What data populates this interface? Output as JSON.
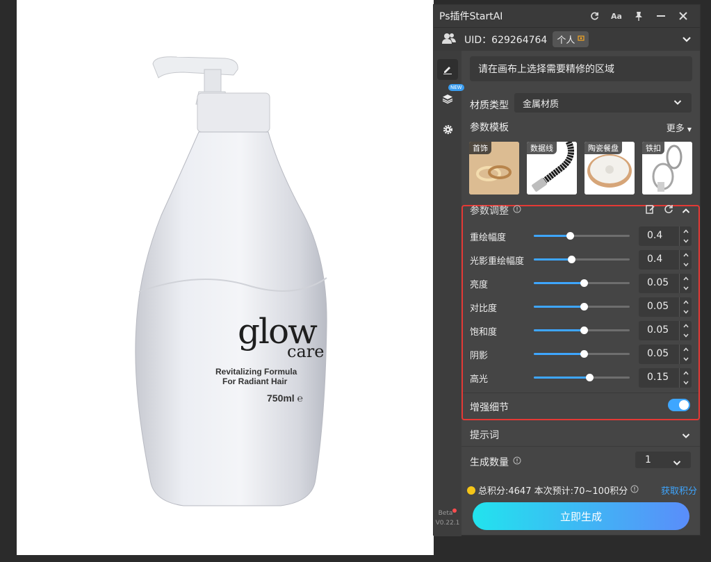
{
  "canvas": {
    "product": {
      "brand_line1": "glow",
      "brand_line2": "care",
      "tagline1": "Revitalizing Formula",
      "tagline2": "For Radiant Hair",
      "volume": "750ml ℮"
    }
  },
  "panel": {
    "title": "Ps插件StartAI",
    "title_buttons": [
      "refresh-icon",
      "font-size-icon",
      "pin-icon",
      "minimize-icon",
      "close-icon"
    ],
    "user": {
      "uid": "UID：629264764",
      "plan": "个人",
      "plan_icon": "badge-icon"
    },
    "sidebar": {
      "items": [
        "edit-icon",
        "layers-icon",
        "settings-icon"
      ],
      "new_badge": "NEW",
      "beta": "Beta",
      "version": "V0.22.1"
    },
    "select_hint": "请在画布上选择需要精修的区域",
    "material": {
      "label": "材质类型",
      "value": "金属材质"
    },
    "templates": {
      "label": "参数模板",
      "more": "更多",
      "items": [
        {
          "label": "首饰",
          "thumb": "rings"
        },
        {
          "label": "数据线",
          "thumb": "cable"
        },
        {
          "label": "陶瓷餐盘",
          "thumb": "plate"
        },
        {
          "label": "铁扣",
          "thumb": "carabiner"
        }
      ]
    },
    "params": {
      "label": "参数调整",
      "items": [
        {
          "label": "重绘幅度",
          "value": "0.4",
          "level": 0.38
        },
        {
          "label": "光影重绘幅度",
          "value": "0.4",
          "level": 0.39
        },
        {
          "label": "亮度",
          "value": "0.05",
          "level": 0.52
        },
        {
          "label": "对比度",
          "value": "0.05",
          "level": 0.52
        },
        {
          "label": "饱和度",
          "value": "0.05",
          "level": 0.52
        },
        {
          "label": "阴影",
          "value": "0.05",
          "level": 0.52
        },
        {
          "label": "高光",
          "value": "0.15",
          "level": 0.58
        }
      ],
      "enhance_label": "增强细节",
      "enhance_on": true
    },
    "prompt_label": "提示词",
    "count": {
      "label": "生成数量",
      "value": "1"
    },
    "credits": {
      "text": "总积分:4647  本次预计:70~100积分",
      "get": "获取积分"
    },
    "generate_label": "立即生成",
    "colors": {
      "accent": "#3ea6ff",
      "highlight_border": "#e53935",
      "panel_bg": "#454545"
    }
  }
}
